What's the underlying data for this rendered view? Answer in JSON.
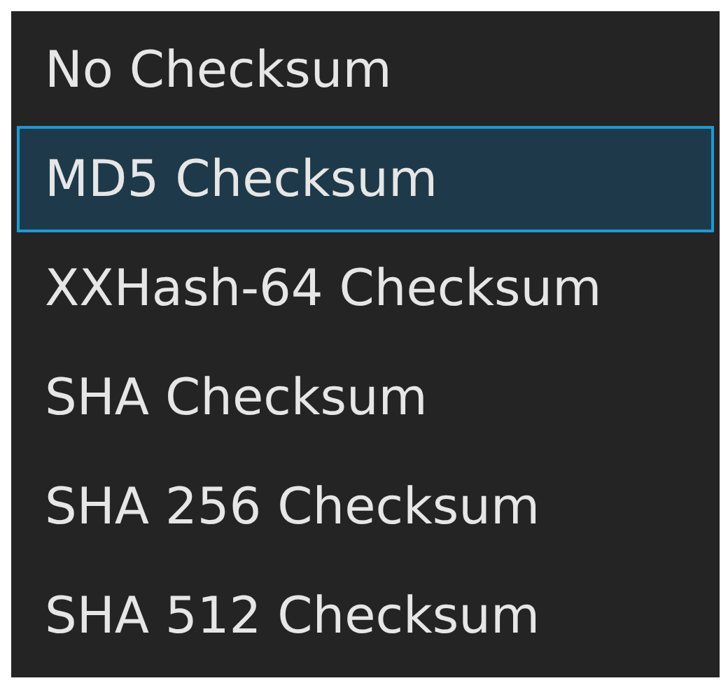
{
  "options": [
    {
      "label": "No Checksum",
      "selected": false
    },
    {
      "label": "MD5 Checksum",
      "selected": true
    },
    {
      "label": "XXHash-64 Checksum",
      "selected": false
    },
    {
      "label": "SHA Checksum",
      "selected": false
    },
    {
      "label": "SHA 256 Checksum",
      "selected": false
    },
    {
      "label": "SHA 512 Checksum",
      "selected": false
    }
  ]
}
